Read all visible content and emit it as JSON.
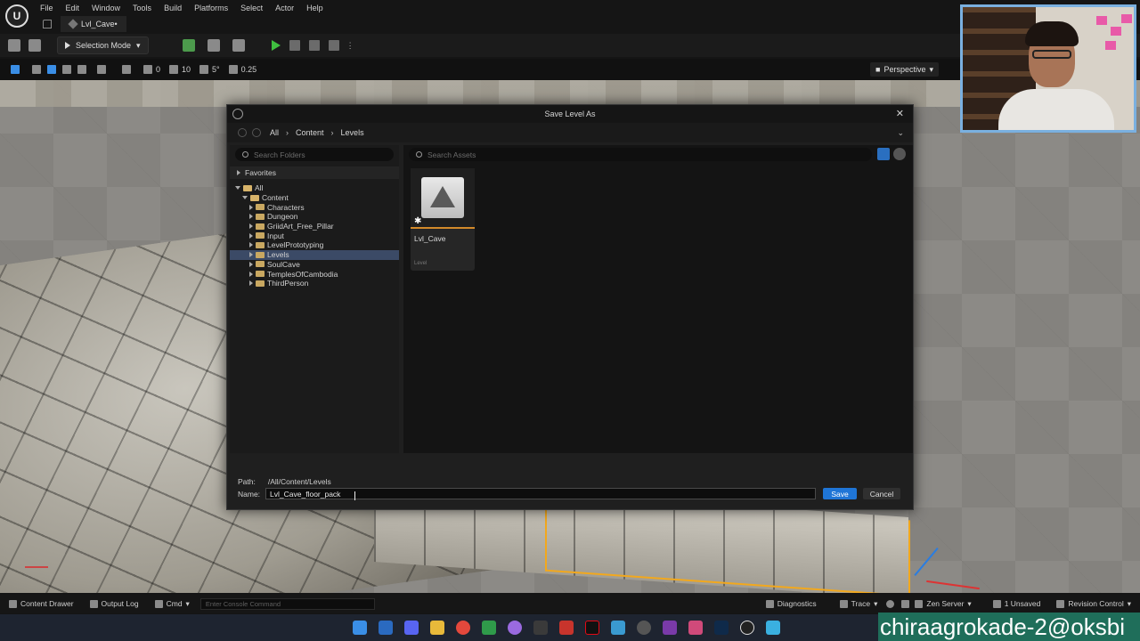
{
  "menu": {
    "items": [
      "File",
      "Edit",
      "Window",
      "Tools",
      "Build",
      "Platforms",
      "Select",
      "Actor",
      "Help"
    ]
  },
  "tab": {
    "title": "Lvl_Cave•"
  },
  "toolbar": {
    "selection_mode": "Selection Mode"
  },
  "viewport_toolbar": {
    "rotation_snap": "0",
    "grid_snap": "10",
    "angle_snap": "5°",
    "scale_snap": "0.25",
    "perspective": "Perspective"
  },
  "dialog": {
    "title": "Save Level As",
    "breadcrumbs": [
      "All",
      "Content",
      "Levels"
    ],
    "folder_search_placeholder": "Search Folders",
    "favorites": "Favorites",
    "tree": [
      {
        "label": "All",
        "depth": 0,
        "expanded": true,
        "selected": false
      },
      {
        "label": "Content",
        "depth": 1,
        "expanded": true,
        "selected": false
      },
      {
        "label": "Characters",
        "depth": 2,
        "expanded": false,
        "selected": false
      },
      {
        "label": "Dungeon",
        "depth": 2,
        "expanded": false,
        "selected": false
      },
      {
        "label": "GriidArt_Free_Pillar",
        "depth": 2,
        "expanded": false,
        "selected": false
      },
      {
        "label": "Input",
        "depth": 2,
        "expanded": false,
        "selected": false
      },
      {
        "label": "LevelPrototyping",
        "depth": 2,
        "expanded": false,
        "selected": false
      },
      {
        "label": "Levels",
        "depth": 2,
        "expanded": false,
        "selected": true
      },
      {
        "label": "SoulCave",
        "depth": 2,
        "expanded": false,
        "selected": false
      },
      {
        "label": "TemplesOfCambodia",
        "depth": 2,
        "expanded": false,
        "selected": false
      },
      {
        "label": "ThirdPerson",
        "depth": 2,
        "expanded": false,
        "selected": false
      }
    ],
    "asset_search_placeholder": "Search Assets",
    "asset": {
      "name": "Lvl_Cave",
      "type": "Level"
    },
    "path_label": "Path:",
    "path_value": "/All/Content/Levels",
    "name_label": "Name:",
    "name_value": "Lvl_Cave_floor_pack",
    "save": "Save",
    "cancel": "Cancel"
  },
  "statusbar": {
    "content_drawer": "Content Drawer",
    "output_log": "Output Log",
    "cmd": "Cmd",
    "console_placeholder": "Enter Console Command",
    "diagnostics": "Diagnostics",
    "trace": "Trace",
    "zen_server": "Zen Server",
    "unsaved": "1 Unsaved",
    "revision_control": "Revision Control"
  },
  "watermark": "chiraagrokade-2@oksbi",
  "colors": {
    "accent": "#1f75d6",
    "selection": "#3b4a66",
    "folder": "#c9a861",
    "play": "#3fbf3f"
  }
}
